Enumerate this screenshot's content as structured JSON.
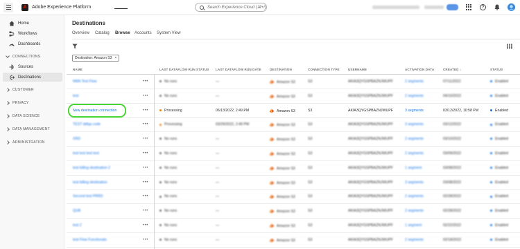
{
  "app": {
    "title": "Adobe Experience Platform",
    "logo_glyph": "A"
  },
  "search": {
    "placeholder": "Search Experience Cloud (⌘+/)"
  },
  "topbar": {
    "icons": [
      "apps-grid-icon",
      "help-icon",
      "notifications-bell-icon",
      "user-avatar"
    ],
    "help_glyph": "?"
  },
  "sidebar": {
    "top_items": [
      {
        "label": "Home",
        "icon": "home-icon"
      },
      {
        "label": "Workflows",
        "icon": "workflows-icon"
      },
      {
        "label": "Dashboards",
        "icon": "dashboards-icon"
      }
    ],
    "connections_label": "CONNECTIONS",
    "connection_items": [
      {
        "label": "Sources",
        "icon": "sources-icon"
      },
      {
        "label": "Destinations",
        "icon": "destinations-icon",
        "active": true
      }
    ],
    "sections": [
      "CUSTOMER",
      "PRIVACY",
      "DATA SCIENCE",
      "DATA MANAGEMENT",
      "ADMINISTRATION"
    ]
  },
  "page": {
    "title": "Destinations",
    "tabs": [
      "Overview",
      "Catalog",
      "Browse",
      "Accounts",
      "System View"
    ],
    "active_tab": "Browse"
  },
  "filter": {
    "chip_label": "Destination: Amazon S3",
    "chip_close": "×"
  },
  "table": {
    "columns": [
      "NAME",
      "LAST DATAFLOW RUN STATUS",
      "LAST DATAFLOW RUN DATE",
      "DESTINATION",
      "CONNECTION TYPE",
      "USERNAME",
      "ACTIVATION DATA",
      "CREATED",
      "STATUS"
    ],
    "sort_indicator": "↓",
    "more_glyph": "•••",
    "rows": [
      {
        "name": "NNN Test Flow",
        "run_status": "No runs",
        "run_date": "—",
        "destination": "Amazon S3",
        "conn_type": "S3",
        "username": "AKIA3QYGSPBAZNJWUPF",
        "activation": "2 segments",
        "created": "07/11/2022",
        "status": "Enabled",
        "blurred": true,
        "status_color": "#6e6e6e"
      },
      {
        "name": "test",
        "run_status": "No runs",
        "run_date": "—",
        "destination": "Amazon S3",
        "conn_type": "S3",
        "username": "AKIA3QYGSPBAZNJWUPF",
        "activation": "2 segments",
        "created": "04/10/2022",
        "status": "Enabled",
        "blurred": true,
        "status_color": "#6e6e6e"
      },
      {
        "name": "New destination connection",
        "run_status": "Processing",
        "run_date": "06/13/2022, 2:49 PM",
        "destination": "Amazon S3",
        "conn_type": "S3",
        "username": "AKIA3QYGSPBAZNJWUPF",
        "activation": "3 segments",
        "created": "03/12/2022, 10:58 PM",
        "status": "Enabled",
        "blurred": false,
        "status_color": "#e68619"
      },
      {
        "name": "TEST ddlqa code",
        "run_status": "Processing",
        "run_date": "03/29/2022, 2:49 PM",
        "destination": "Amazon S3",
        "conn_type": "S3",
        "username": "AKIA3QYGSPBAZNJWUPF",
        "activation": "3 segments",
        "created": "03/12/2022",
        "status": "Enabled",
        "blurred": true,
        "status_color": "#e68619"
      },
      {
        "name": "XRD",
        "run_status": "No runs",
        "run_date": "—",
        "destination": "Amazon S3",
        "conn_type": "S3",
        "username": "AKIA3QYGSPBAZNJWUPF",
        "activation": "2 segments",
        "created": "03/10/2022",
        "status": "Enabled",
        "blurred": true,
        "status_color": "#6e6e6e"
      },
      {
        "name": "test test test test",
        "run_status": "No runs",
        "run_date": "—",
        "destination": "Amazon S3",
        "conn_type": "S3",
        "username": "AKIA3QYGSPBAZNJWUPF",
        "activation": "2 segments",
        "created": "03/09/2022",
        "status": "Enabled",
        "blurred": true,
        "status_color": "#6e6e6e"
      },
      {
        "name": "test billing destination 2",
        "run_status": "No runs",
        "run_date": "—",
        "destination": "Amazon S3",
        "conn_type": "S3",
        "username": "AKIA3QYGSPBAZNJWUPF",
        "activation": "1 segment",
        "created": "03/08/2022",
        "status": "Enabled",
        "blurred": true,
        "status_color": "#6e6e6e"
      },
      {
        "name": "test billing destination",
        "run_status": "No runs",
        "run_date": "—",
        "destination": "Amazon S3",
        "conn_type": "S3",
        "username": "AKIA3QYGSPBAZNJWUPF",
        "activation": "3 segments",
        "created": "03/08/2022",
        "status": "Enabled",
        "blurred": true,
        "status_color": "#6e6e6e"
      },
      {
        "name": "Second test PRRD",
        "run_status": "No runs",
        "run_date": "—",
        "destination": "Amazon S3",
        "conn_type": "S3",
        "username": "AKIA3QYGSPBAZNJWUPF",
        "activation": "2 segments",
        "created": "02/28/2022",
        "status": "Enabled",
        "blurred": true,
        "status_color": "#6e6e6e"
      },
      {
        "name": "QUB",
        "run_status": "No runs",
        "run_date": "—",
        "destination": "Amazon S3",
        "conn_type": "S3",
        "username": "AKIA3QYGSPBAZNJWUPF",
        "activation": "2 segments",
        "created": "02/28/2022",
        "status": "Enabled",
        "blurred": true,
        "status_color": "#6e6e6e"
      },
      {
        "name": "test 2",
        "run_status": "No runs",
        "run_date": "—",
        "destination": "Amazon S3",
        "conn_type": "S3",
        "username": "AKIA3QYGSPBAZNJWUPF",
        "activation": "1 segment",
        "created": "02/22/2022",
        "status": "Enabled",
        "blurred": true,
        "status_color": "#6e6e6e"
      },
      {
        "name": "test Flow Functionals",
        "run_status": "No runs",
        "run_date": "—",
        "destination": "Amazon S3",
        "conn_type": "S3",
        "username": "AKIA3QYGSPBAZNJWUPF",
        "activation": "2 segments",
        "created": "02/18/2022",
        "status": "Enabled",
        "blurred": true,
        "status_color": "#6e6e6e"
      }
    ]
  },
  "colors": {
    "link": "#1473e6",
    "processing": "#e68619",
    "enabled": "#1473e6",
    "focus": "#48d634",
    "s3_orange": "#f4821f"
  }
}
